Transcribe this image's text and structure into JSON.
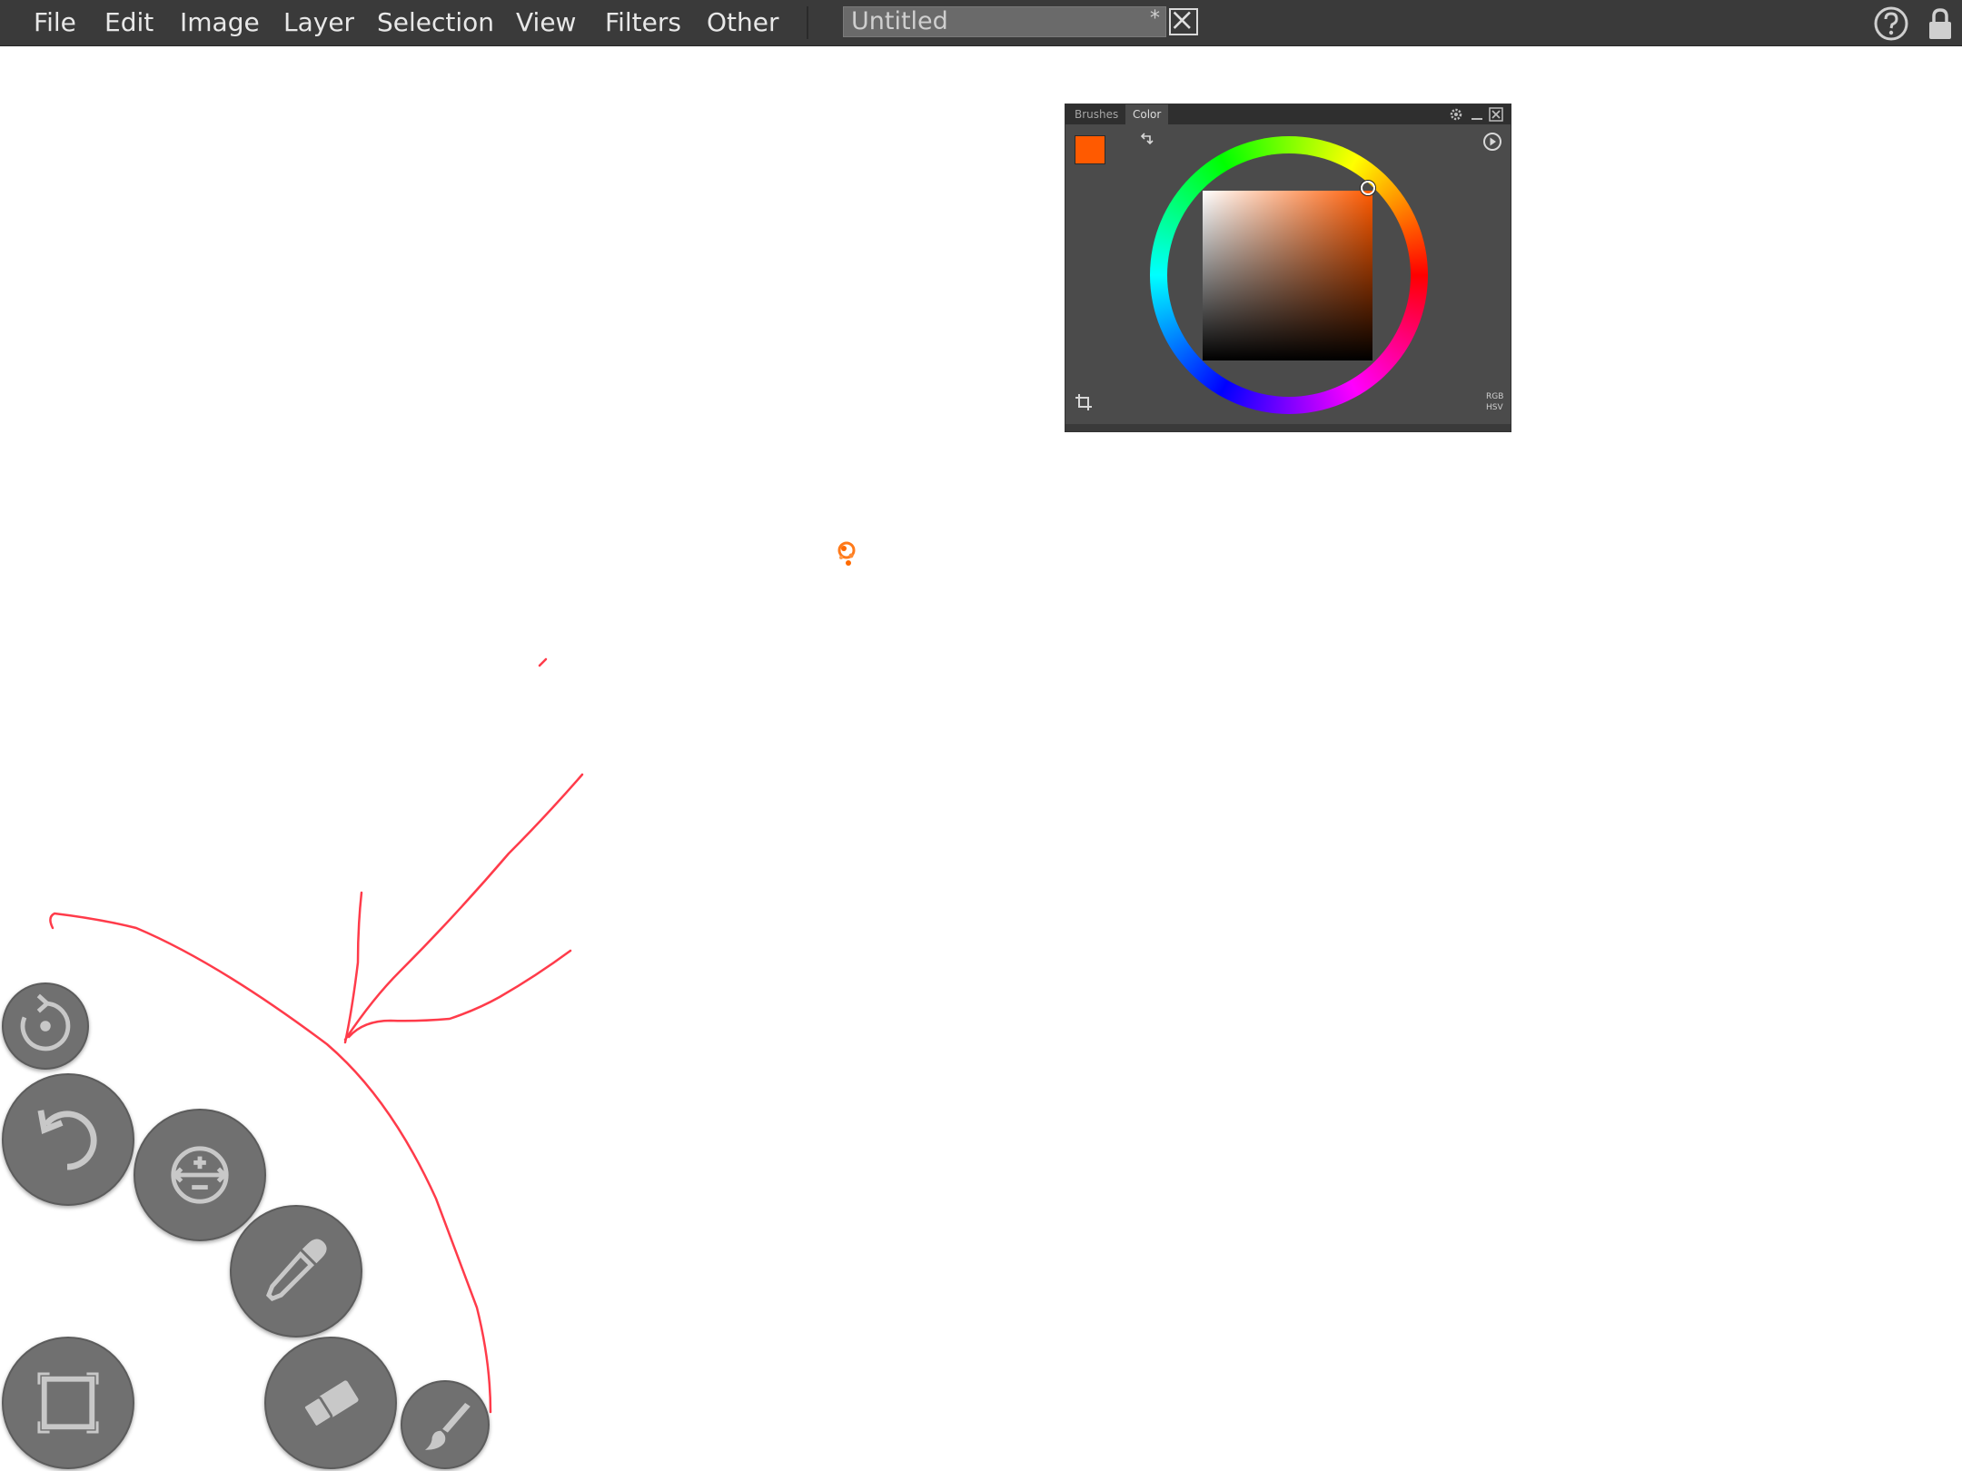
{
  "menubar": {
    "items": [
      "File",
      "Edit",
      "Image",
      "Layer",
      "Selection",
      "View",
      "Filters",
      "Other"
    ],
    "document": {
      "title": "Untitled",
      "modified_mark": "*"
    }
  },
  "color_panel": {
    "tabs": [
      {
        "label": "Brushes",
        "active": false
      },
      {
        "label": "Color",
        "active": true
      }
    ],
    "current_color": "#ff5a00",
    "modes": {
      "rgb": "RGB",
      "hsv": "HSV"
    }
  },
  "icons": {
    "menubar": [
      "close-icon",
      "help-icon",
      "lock-icon"
    ],
    "panel": [
      "gear-icon",
      "minimize-icon",
      "close-icon",
      "swap-icon",
      "play-icon",
      "crop-icon"
    ],
    "tools": [
      "rotate-reset-icon",
      "undo-icon",
      "zoom-pan-icon",
      "eyedropper-icon",
      "fullscreen-icon",
      "eraser-icon",
      "brush-icon"
    ]
  },
  "colors": {
    "menubar_bg": "#3a3a3a",
    "panel_bg": "#4b4b4b",
    "tool_bg": "#707070",
    "stroke": "#ff3b4a"
  }
}
